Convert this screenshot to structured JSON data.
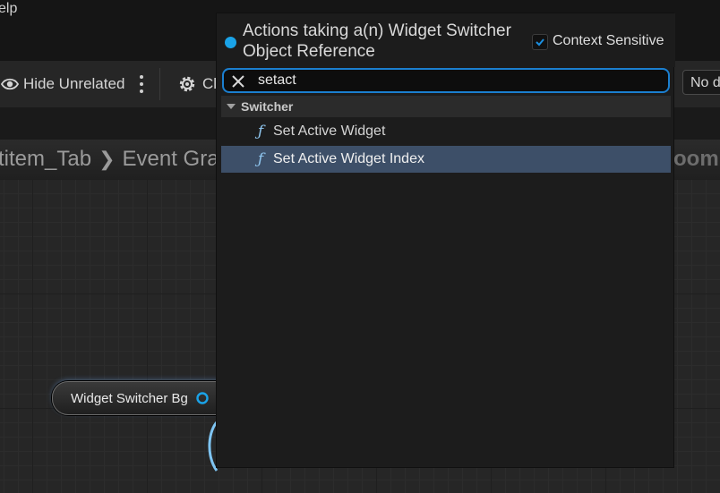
{
  "menubar": {
    "partial_text": "elp"
  },
  "toolbar": {
    "hide_unrelated_label": "Hide Unrelated",
    "class_settings_partial": "Cl",
    "dropdown_partial": "No d"
  },
  "graph": {
    "breadcrumb": [
      "titem_Tab",
      "Event Grap"
    ],
    "zoom_partial": "oom",
    "node": {
      "label": "Widget Switcher Bg"
    }
  },
  "popup": {
    "title": "Actions taking a(n) Widget Switcher Object Reference",
    "context_sensitive": {
      "label": "Context Sensitive",
      "checked": true
    },
    "search": {
      "value": "setact",
      "clear_icon": "close-icon"
    },
    "category": {
      "label": "Switcher",
      "expanded": true
    },
    "actions": [
      {
        "label": "Set Active Widget",
        "icon": "function-icon",
        "selected": false
      },
      {
        "label": "Set Active Widget Index",
        "icon": "function-icon",
        "selected": true
      }
    ]
  },
  "colors": {
    "accent_blue": "#1b7fd0",
    "context_dot": "#1aa3e8",
    "selection": "#3d4f68",
    "function_icon": "#8fc6ef"
  }
}
